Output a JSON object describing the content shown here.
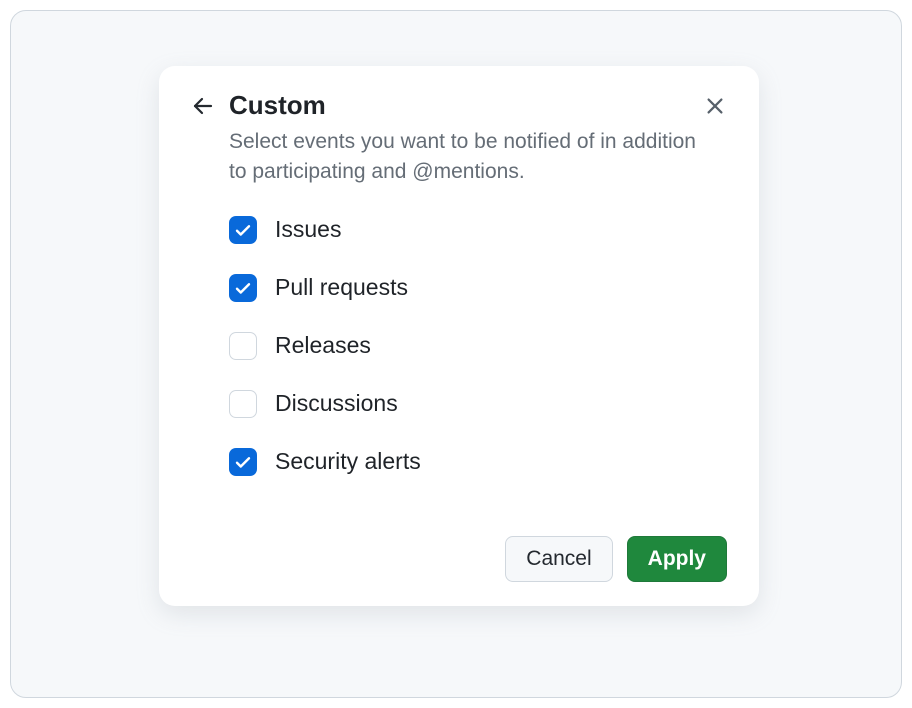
{
  "dialog": {
    "title": "Custom",
    "subtitle": "Select events you want to be notified of in addition to participating and @mentions.",
    "options": [
      {
        "label": "Issues",
        "checked": true
      },
      {
        "label": "Pull requests",
        "checked": true
      },
      {
        "label": "Releases",
        "checked": false
      },
      {
        "label": "Discussions",
        "checked": false
      },
      {
        "label": "Security alerts",
        "checked": true
      }
    ],
    "buttons": {
      "cancel": "Cancel",
      "apply": "Apply"
    }
  }
}
